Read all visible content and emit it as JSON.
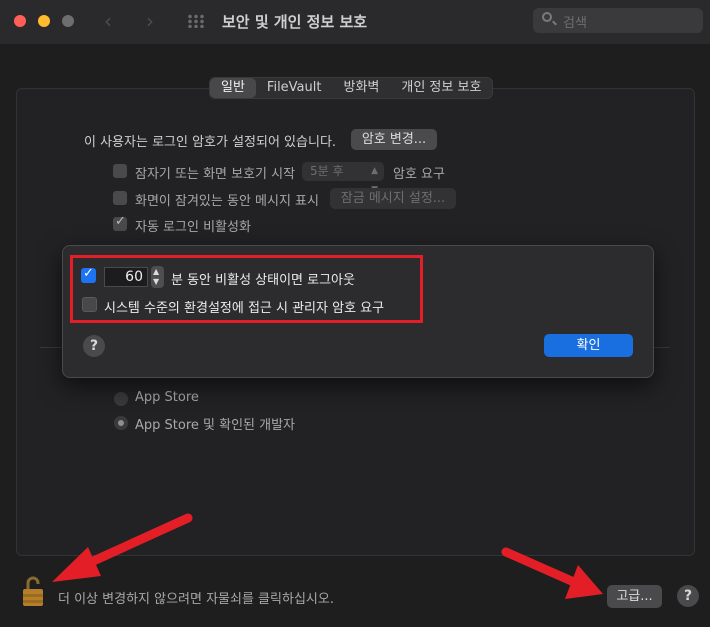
{
  "window": {
    "title": "보안 및 개인 정보 보호",
    "search_placeholder": "검색",
    "traffic_lights": {
      "close": "#ff5f57",
      "minimize": "#febc2e",
      "zoom": "#6e6e70"
    }
  },
  "tabs": [
    {
      "label": "일반",
      "active": true
    },
    {
      "label": "FileVault",
      "active": false
    },
    {
      "label": "방화벽",
      "active": false
    },
    {
      "label": "개인 정보 보호",
      "active": false
    }
  ],
  "general": {
    "password_message": "이 사용자는 로그인 암호가 설정되어 있습니다.",
    "change_password_button": "암호 변경...",
    "require_password": {
      "label_before": "잠자기 또는 화면 보호기 시작",
      "popup_value": "5분 후",
      "label_after": "암호 요구",
      "checked": false
    },
    "show_message": {
      "label": "화면이 잠겨있는 동안 메시지 표시",
      "checked": false
    },
    "set_lock_message_button": "잠금 메시지 설정...",
    "disable_auto_login": {
      "label": "자동 로그인 비활성화",
      "checked": true
    },
    "downloads": {
      "options": [
        {
          "label": "App Store",
          "selected": false
        },
        {
          "label": "App Store 및 확인된 개발자",
          "selected": true
        }
      ]
    }
  },
  "dialog": {
    "logout": {
      "checked": true,
      "minutes": "60",
      "label": "분 동안 비활성 상태이면 로그아웃"
    },
    "admin_password": {
      "checked": false,
      "label": "시스템 수준의 환경설정에 접근 시 관리자 암호 요구"
    },
    "help_label": "?",
    "ok_button": "확인",
    "highlight_color": "#e41e26"
  },
  "footer": {
    "lock_message": "더 이상 변경하지 않으려면 자물쇠를 클릭하십시오.",
    "advanced_button": "고급...",
    "help_label": "?"
  },
  "annotations": {
    "arrow_color": "#e41e26"
  }
}
